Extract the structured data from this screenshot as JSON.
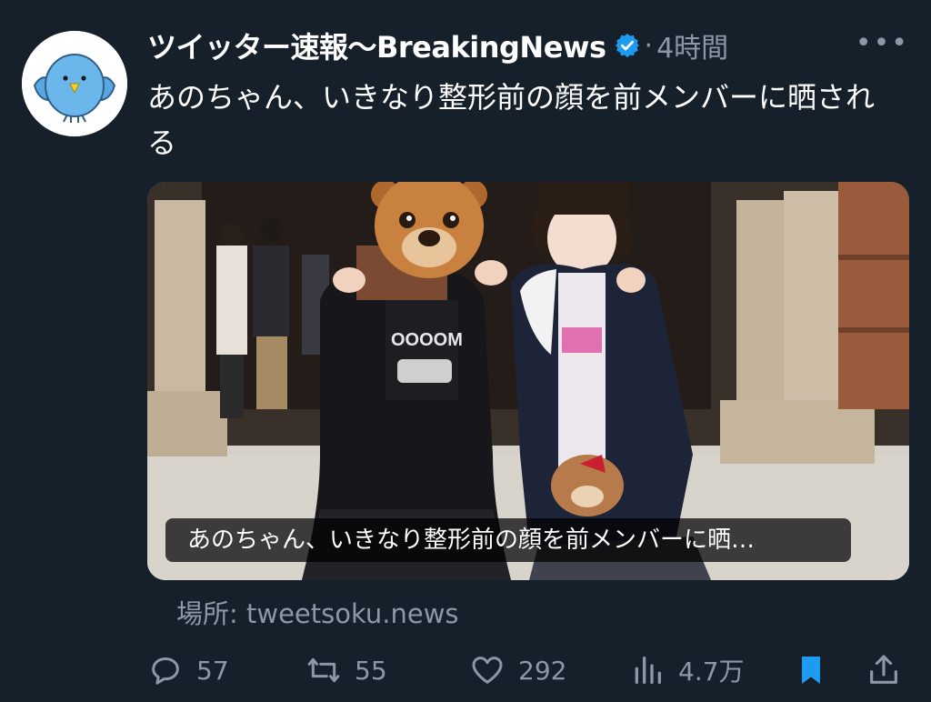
{
  "tweet": {
    "display_name": "ツイッター速報〜BreakingNews",
    "separator": "·",
    "time": "4時間",
    "more": "•••",
    "text": "あのちゃん、いきなり整形前の顔を前メンバーに晒される"
  },
  "card": {
    "caption": "あのちゃん、いきなり整形前の顔を前メンバーに晒…",
    "source": "場所: tweetsoku.news"
  },
  "actions": {
    "replies": "57",
    "retweets": "55",
    "likes": "292",
    "views": "4.7万"
  },
  "icons": {
    "avatar": "blue-bird-avatar",
    "verified": "verified-badge-icon",
    "reply": "speech-bubble-icon",
    "retweet": "retweet-icon",
    "like": "heart-icon",
    "views": "bar-chart-icon",
    "bookmark": "bookmark-icon",
    "share": "share-icon"
  },
  "colors": {
    "background": "#15202b",
    "text": "#ffffff",
    "muted": "#8b98a5",
    "accent": "#1d9bf0"
  }
}
